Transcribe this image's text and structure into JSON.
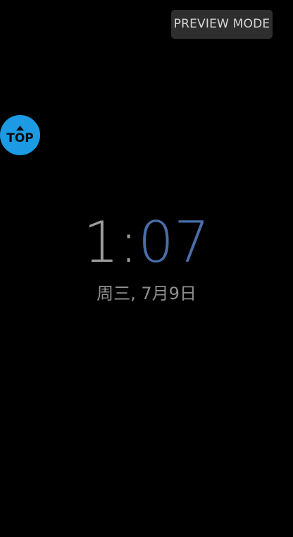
{
  "header": {
    "preview_mode_label": "PREVIEW MODE"
  },
  "scroll_top": {
    "label": "TOP",
    "icon": "arrow-up-icon",
    "color": "#1c9be4"
  },
  "clock": {
    "hours": "1",
    "separator": ":",
    "minutes": "07",
    "hours_color": "#9c9c9c",
    "minutes_color": "#4a6ea9"
  },
  "date": {
    "text": "周三, 7月9日"
  }
}
